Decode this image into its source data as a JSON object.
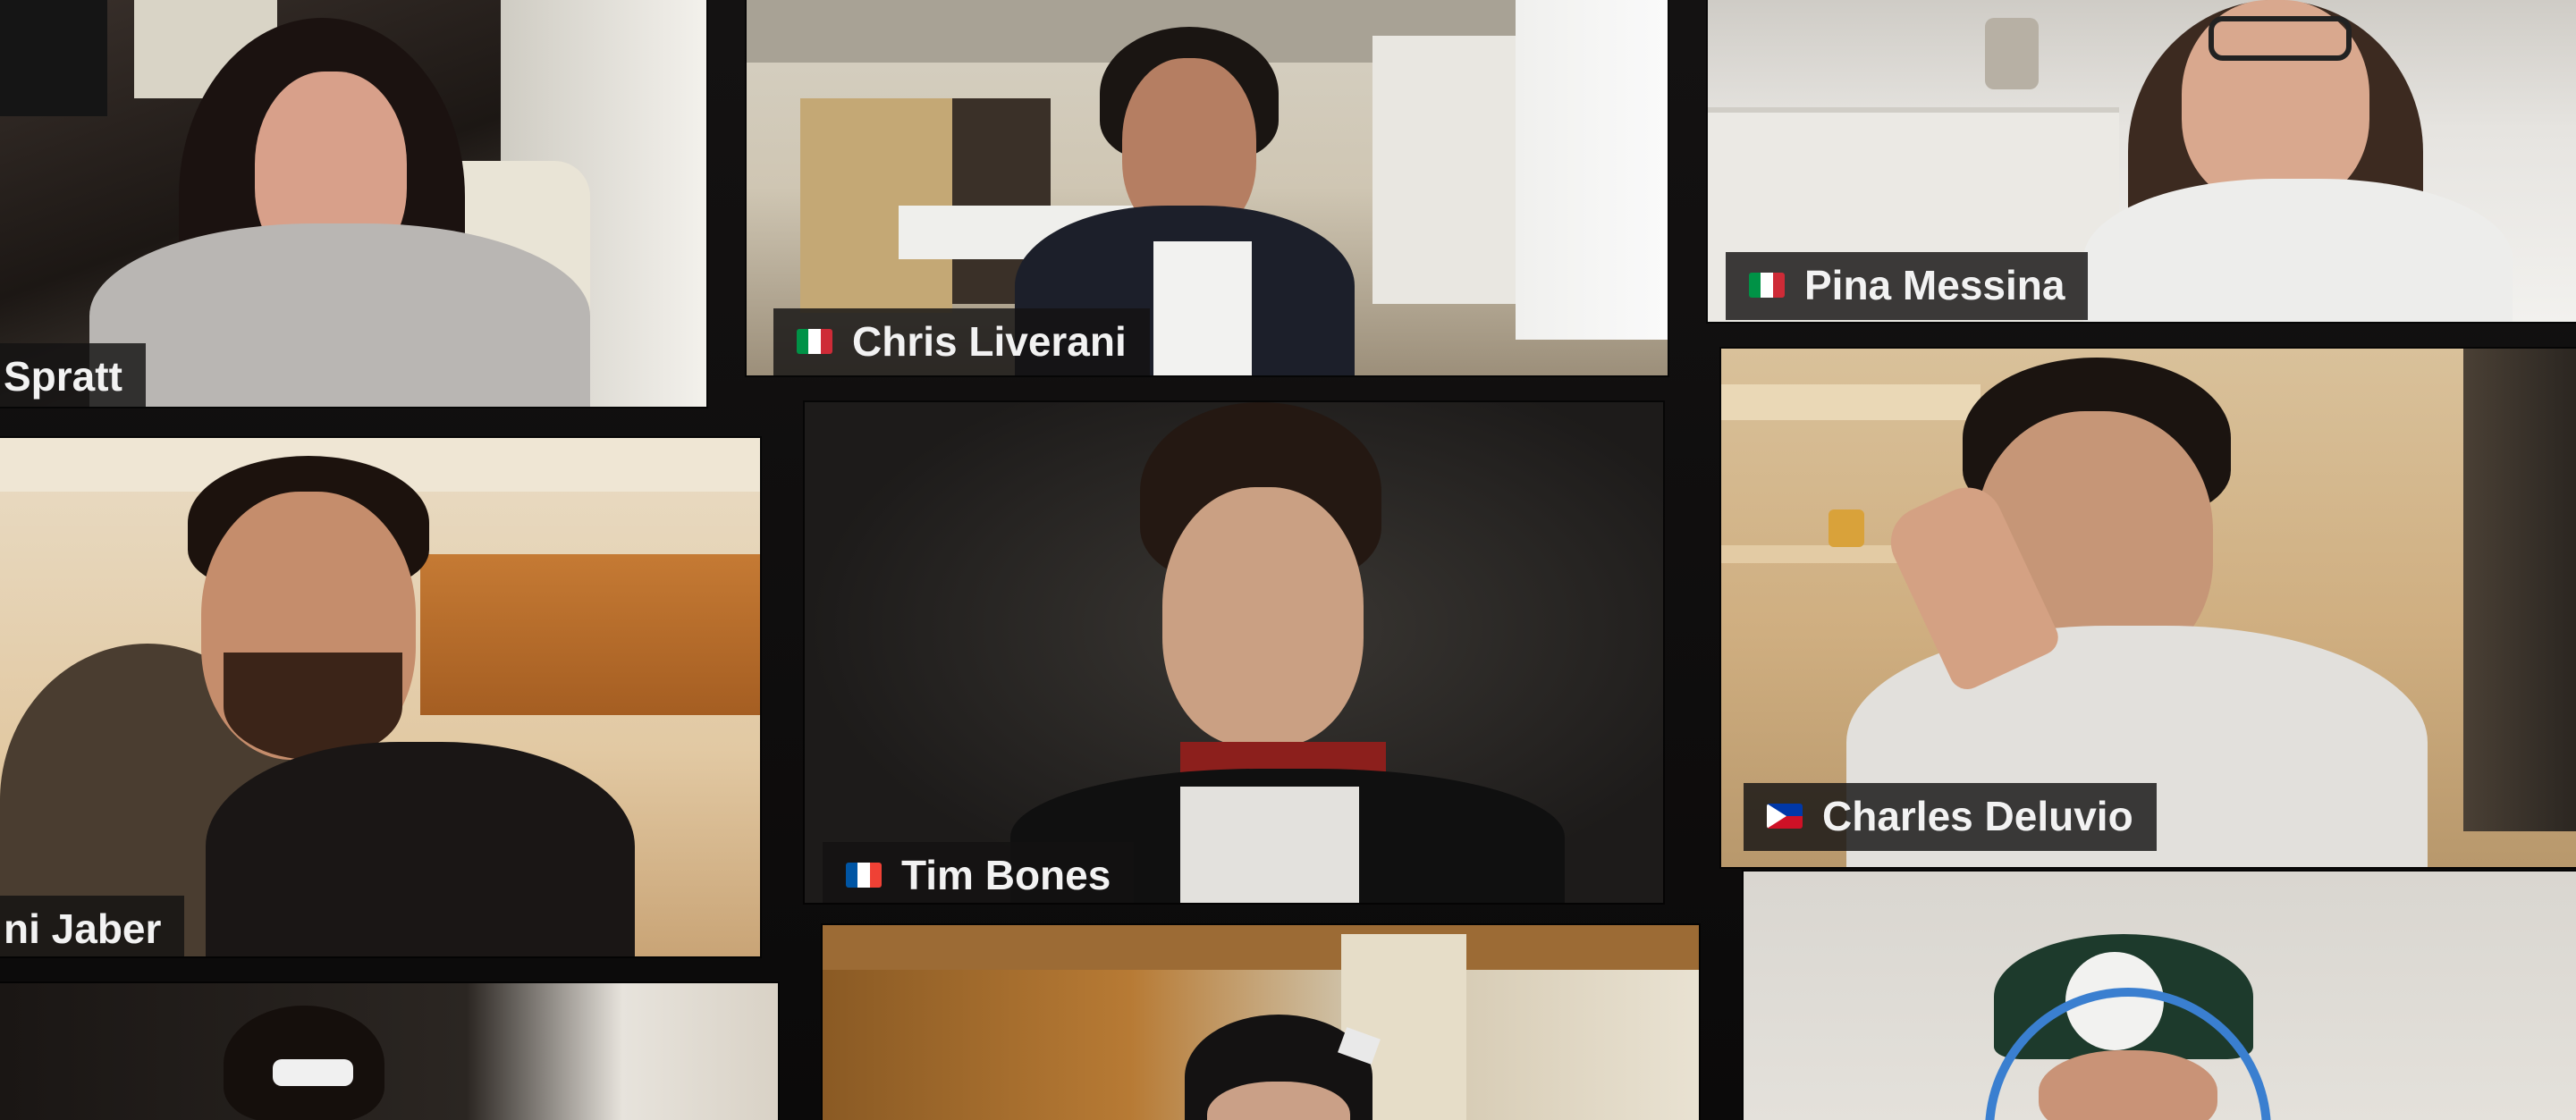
{
  "app": {
    "view": "gallery"
  },
  "participants": [
    {
      "name": "Spratt",
      "flag": ""
    },
    {
      "name": "Chris Liverani",
      "flag": "italy"
    },
    {
      "name": "Pina Messina",
      "flag": "italy"
    },
    {
      "name": "ni Jaber",
      "flag": ""
    },
    {
      "name": "Tim Bones",
      "flag": "france"
    },
    {
      "name": "Charles Deluvio",
      "flag": "philippines"
    },
    {
      "name": "",
      "flag": ""
    },
    {
      "name": "",
      "flag": ""
    },
    {
      "name": "",
      "flag": ""
    }
  ],
  "flag_colors": {
    "italy": [
      "#009246",
      "#ffffff",
      "#ce2b37"
    ],
    "france": [
      "#0055a4",
      "#ffffff",
      "#ef4135"
    ],
    "philippines": [
      "#0038a8",
      "#ce1126",
      "#ffffff"
    ]
  }
}
